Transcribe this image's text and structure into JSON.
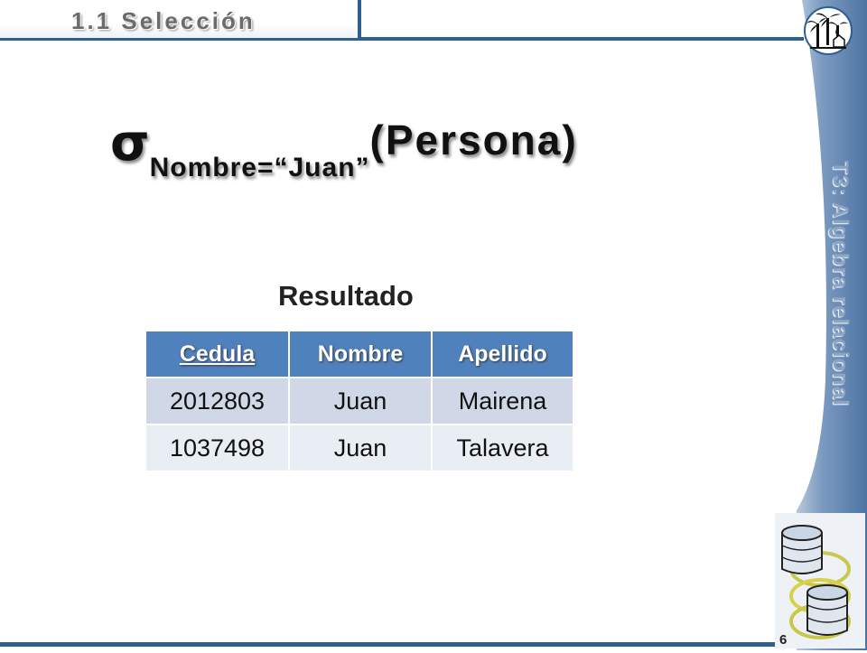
{
  "header": {
    "title": "1.1 Selección"
  },
  "side_title": "T3: Algebra relacional",
  "formula": {
    "symbol": "σ",
    "condition": "Nombre=“Juan”",
    "relation": "(Persona)"
  },
  "result_label": "Resultado",
  "table": {
    "headers": [
      "Cedula",
      "Nombre",
      "Apellido"
    ],
    "rows": [
      [
        "2012803",
        "Juan",
        "Mairena"
      ],
      [
        "1037498",
        "Juan",
        "Talavera"
      ]
    ]
  },
  "page_number": "6",
  "colors": {
    "accent": "#2e5f91",
    "header_fill": "#4f81bd",
    "row_a": "#d0d8e8",
    "row_b": "#e9edf4",
    "side_band": "#6e8fb8"
  },
  "icons": [
    "palm-logo-icon",
    "database-icon"
  ]
}
